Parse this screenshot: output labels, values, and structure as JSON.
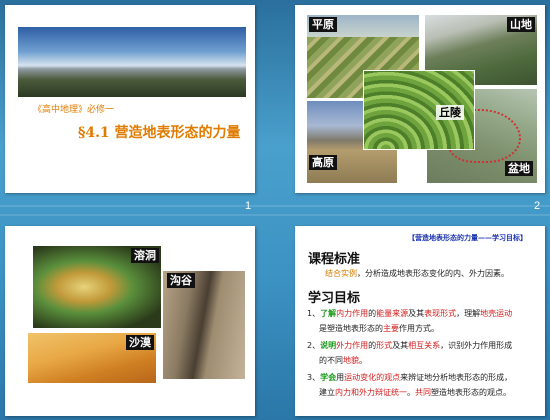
{
  "slide1": {
    "subtitle": "《高中地理》必修一",
    "title": "§4.1 营造地表形态的力量",
    "number": "1"
  },
  "slide2": {
    "labels": {
      "pingyuan": "平原",
      "shandi": "山地",
      "qiuling": "丘陵",
      "gaoyuan": "高原",
      "pendi": "盆地"
    },
    "number": "2"
  },
  "slide3": {
    "labels": {
      "rongdong": "溶洞",
      "gougu": "沟谷",
      "shamo": "沙漠"
    }
  },
  "slide4": {
    "header": "【营造地表形态的力量——学习目标】",
    "kecheng_heading": "课程标准",
    "kecheng_line": {
      "a": "结合实例",
      "b": "，分析造成地表形态变化的内、外力因素。"
    },
    "mubiao_heading": "学习目标",
    "goal1": {
      "n": "1、",
      "a": "了解",
      "b": "内力作用",
      "c": "的",
      "d": "能量来源",
      "e": "及其",
      "f": "表现形式",
      "g": "，理解",
      "h": "地壳运动",
      "cont": "是塑造地表形态的",
      "cont_r": "主要",
      "cont_end": "作用方式。"
    },
    "goal2": {
      "n": "2、",
      "a": "说明",
      "b": "外力作用",
      "c": "的",
      "d": "形式",
      "e": "及其",
      "f": "相互关系",
      "g": "，识别外力作用形成",
      "cont": "的不同",
      "cont_r": "地貌",
      "cont_end": "。"
    },
    "goal3": {
      "n": "3、",
      "a": "学会",
      "b": "用",
      "c": "运动变化的观点",
      "d": "来辨证地分析地表形态的形成，",
      "cont": "建立",
      "cont_r": "内力和外力辩证统一",
      "cont_mid": "。",
      "cont_g": "共同",
      "cont_end": "塑造地表形态的观点。"
    }
  }
}
